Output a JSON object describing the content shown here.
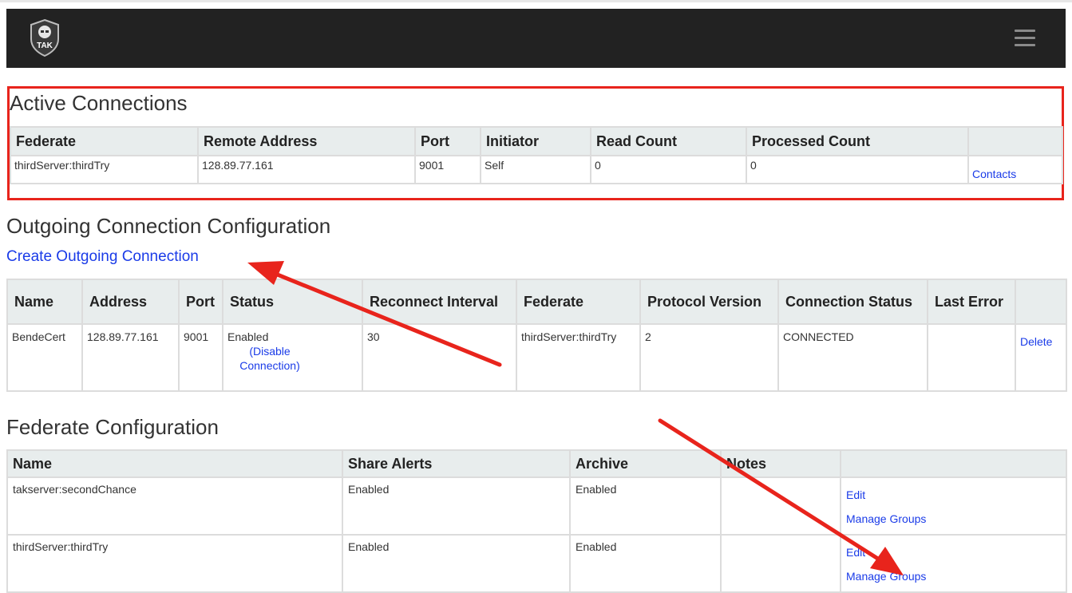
{
  "brand": {
    "logo_text": "TAK"
  },
  "colors": {
    "navbar": "#222222",
    "header_cell": "#e8eded",
    "link": "#1a3be8",
    "annotation": "#e8241c"
  },
  "active": {
    "title": "Active Connections",
    "columns": [
      "Federate",
      "Remote Address",
      "Port",
      "Initiator",
      "Read Count",
      "Processed Count",
      ""
    ],
    "rows": [
      {
        "federate": "thirdServer:thirdTry",
        "address": "128.89.77.161",
        "port": "9001",
        "initiator": "Self",
        "read": "0",
        "processed": "0",
        "action": "Contacts"
      }
    ]
  },
  "outgoing": {
    "title": "Outgoing Connection Configuration",
    "create_link": "Create Outgoing Connection",
    "columns": [
      "Name",
      "Address",
      "Port",
      "Status",
      "Reconnect Interval",
      "Federate",
      "Protocol Version",
      "Connection Status",
      "Last Error",
      ""
    ],
    "rows": [
      {
        "name": "BendeCert",
        "address": "128.89.77.161",
        "port": "9001",
        "status": "Enabled",
        "status_action": "(Disable Connection)",
        "interval": "30",
        "federate": "thirdServer:thirdTry",
        "protocol": "2",
        "conn_status": "CONNECTED",
        "last_error": "",
        "action": "Delete"
      }
    ]
  },
  "federate": {
    "title": "Federate Configuration",
    "columns": [
      "Name",
      "Share Alerts",
      "Archive",
      "Notes",
      ""
    ],
    "rows": [
      {
        "name": "takserver:secondChance",
        "share_alerts": "Enabled",
        "archive": "Enabled",
        "notes": "",
        "edit": "Edit",
        "manage": "Manage Groups"
      },
      {
        "name": "thirdServer:thirdTry",
        "share_alerts": "Enabled",
        "archive": "Enabled",
        "notes": "",
        "edit": "Edit",
        "manage": "Manage Groups"
      }
    ]
  }
}
